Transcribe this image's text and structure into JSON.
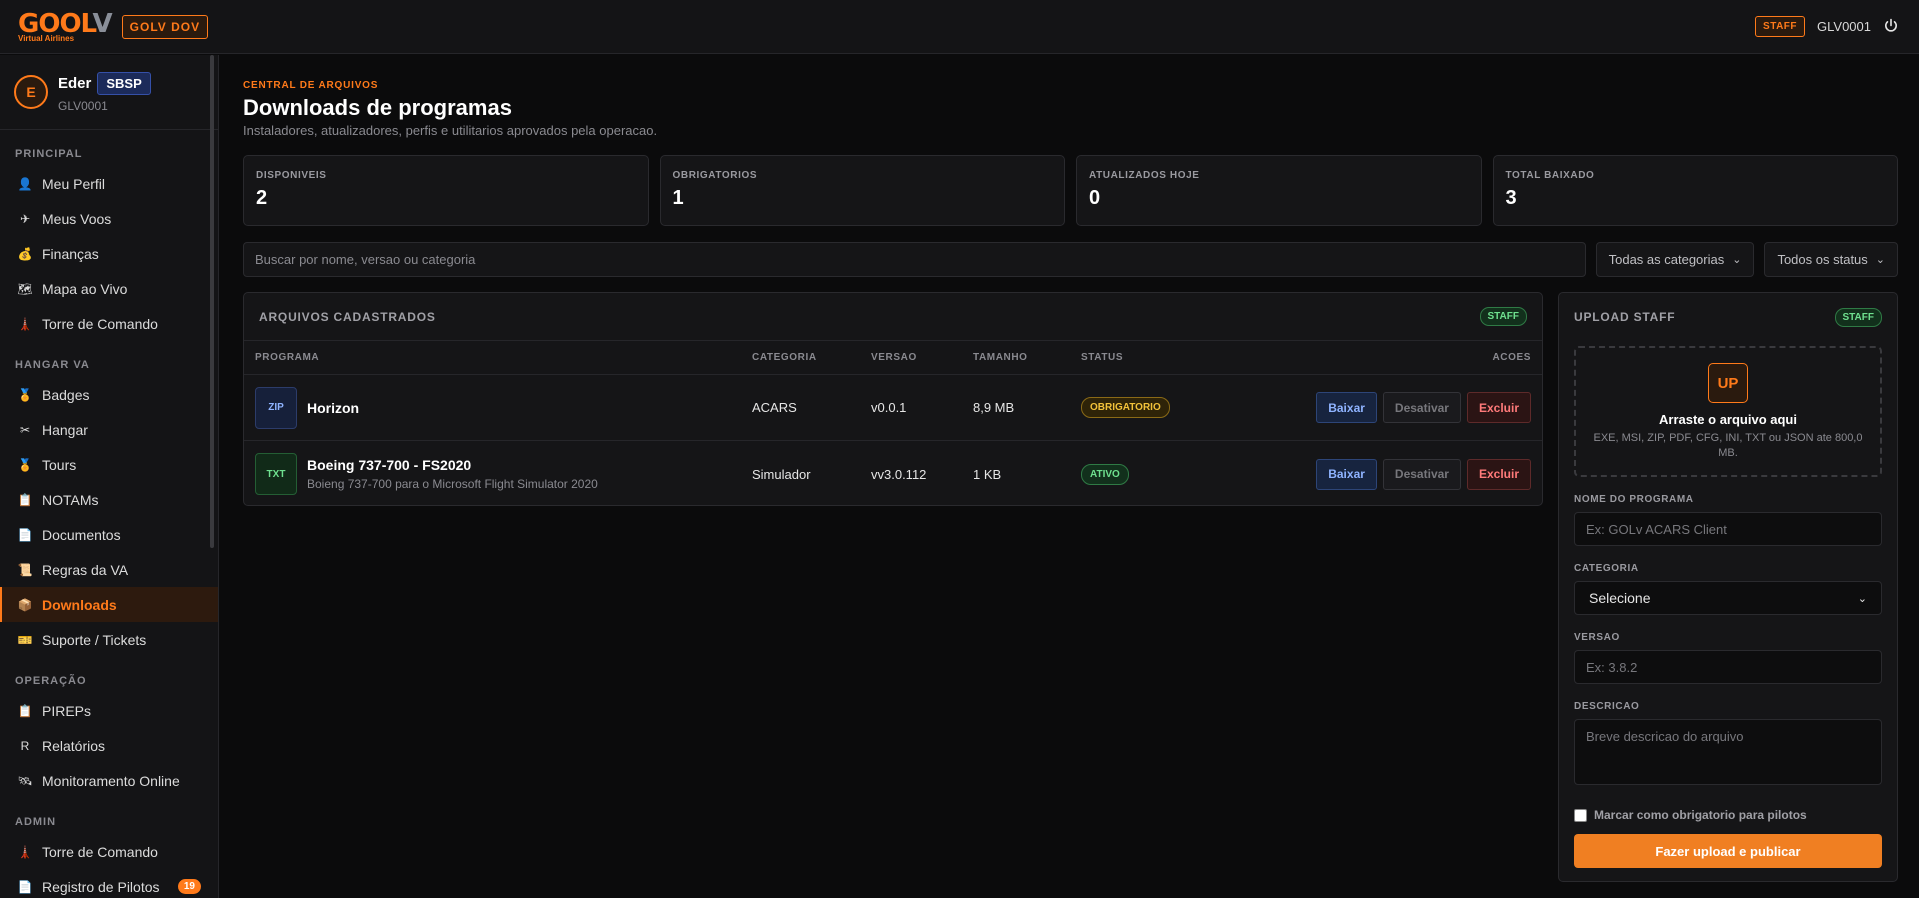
{
  "topbar": {
    "logo_text_orange": "GO",
    "logo_text_o": "OL",
    "logo_text_v": "V",
    "logo_sub": "Virtual Airlines",
    "brand_badge": "GOLV DOV",
    "staff_label": "STAFF",
    "user_code": "GLV0001"
  },
  "sidebar": {
    "user": {
      "initial": "E",
      "name": "Eder",
      "airport": "SBSP",
      "code": "GLV0001"
    },
    "sections": [
      {
        "title": "PRINCIPAL",
        "items": [
          {
            "label": "Meu Perfil",
            "icon": "👤"
          },
          {
            "label": "Meus Voos",
            "icon": "✈"
          },
          {
            "label": "Finanças",
            "icon": "💰"
          },
          {
            "label": "Mapa ao Vivo",
            "icon": "🗺"
          },
          {
            "label": "Torre de Comando",
            "icon": "🗼"
          }
        ]
      },
      {
        "title": "HANGAR VA",
        "items": [
          {
            "label": "Badges",
            "icon": "🏅"
          },
          {
            "label": "Hangar",
            "icon": "✂"
          },
          {
            "label": "Tours",
            "icon": "🏅"
          },
          {
            "label": "NOTAMs",
            "icon": "📋"
          },
          {
            "label": "Documentos",
            "icon": "📄"
          },
          {
            "label": "Regras da VA",
            "icon": "📜"
          },
          {
            "label": "Downloads",
            "icon": "📦"
          },
          {
            "label": "Suporte / Tickets",
            "icon": "🎫"
          }
        ]
      },
      {
        "title": "OPERAÇÃO",
        "items": [
          {
            "label": "PIREPs",
            "icon": "📋"
          },
          {
            "label": "Relatórios",
            "icon": "R"
          },
          {
            "label": "Monitoramento Online",
            "icon": "🛰"
          }
        ]
      },
      {
        "title": "ADMIN",
        "items": [
          {
            "label": "Torre de Comando",
            "icon": "🗼"
          },
          {
            "label": "Registro de Pilotos",
            "icon": "📄",
            "badge": "19"
          }
        ]
      }
    ]
  },
  "header": {
    "eyebrow": "CENTRAL DE ARQUIVOS",
    "title": "Downloads de programas",
    "subtitle": "Instaladores, atualizadores, perfis e utilitarios aprovados pela operacao."
  },
  "stats": [
    {
      "label": "DISPONIVEIS",
      "value": "2"
    },
    {
      "label": "OBRIGATORIOS",
      "value": "1"
    },
    {
      "label": "ATUALIZADOS HOJE",
      "value": "0"
    },
    {
      "label": "TOTAL BAIXADO",
      "value": "3"
    }
  ],
  "filters": {
    "search_placeholder": "Buscar por nome, versao ou categoria",
    "category_selected": "Todas as categorias",
    "status_selected": "Todos os status"
  },
  "files_panel": {
    "title": "ARQUIVOS CADASTRADOS",
    "badge": "STAFF",
    "columns": {
      "program": "PROGRAMA",
      "category": "CATEGORIA",
      "version": "VERSAO",
      "size": "TAMANHO",
      "status": "STATUS",
      "actions": "ACOES"
    },
    "rows": [
      {
        "type": "ZIP",
        "name": "Horizon",
        "desc": "",
        "category": "ACARS",
        "version": "v0.0.1",
        "size": "8,9 MB",
        "status": "OBRIGATORIO",
        "status_kind": "yellow"
      },
      {
        "type": "TXT",
        "name": "Boeing 737-700 - FS2020",
        "desc": "Boieng 737-700 para o Microsoft Flight Simulator 2020",
        "category": "Simulador",
        "version": "vv3.0.112",
        "size": "1 KB",
        "status": "ATIVO",
        "status_kind": "green"
      }
    ],
    "actions": {
      "download": "Baixar",
      "disable": "Desativar",
      "delete": "Excluir"
    }
  },
  "upload": {
    "title": "UPLOAD STAFF",
    "badge": "STAFF",
    "drop_icon": "UP",
    "drop_title": "Arraste o arquivo aqui",
    "drop_sub": "EXE, MSI, ZIP, PDF, CFG, INI, TXT ou JSON ate 800,0 MB.",
    "name_label": "NOME DO PROGRAMA",
    "name_placeholder": "Ex: GOLv ACARS Client",
    "category_label": "CATEGORIA",
    "category_selected": "Selecione",
    "version_label": "VERSAO",
    "version_placeholder": "Ex: 3.8.2",
    "desc_label": "DESCRICAO",
    "desc_placeholder": "Breve descricao do arquivo",
    "required_label": "Marcar como obrigatorio para pilotos",
    "submit_label": "Fazer upload e publicar"
  }
}
